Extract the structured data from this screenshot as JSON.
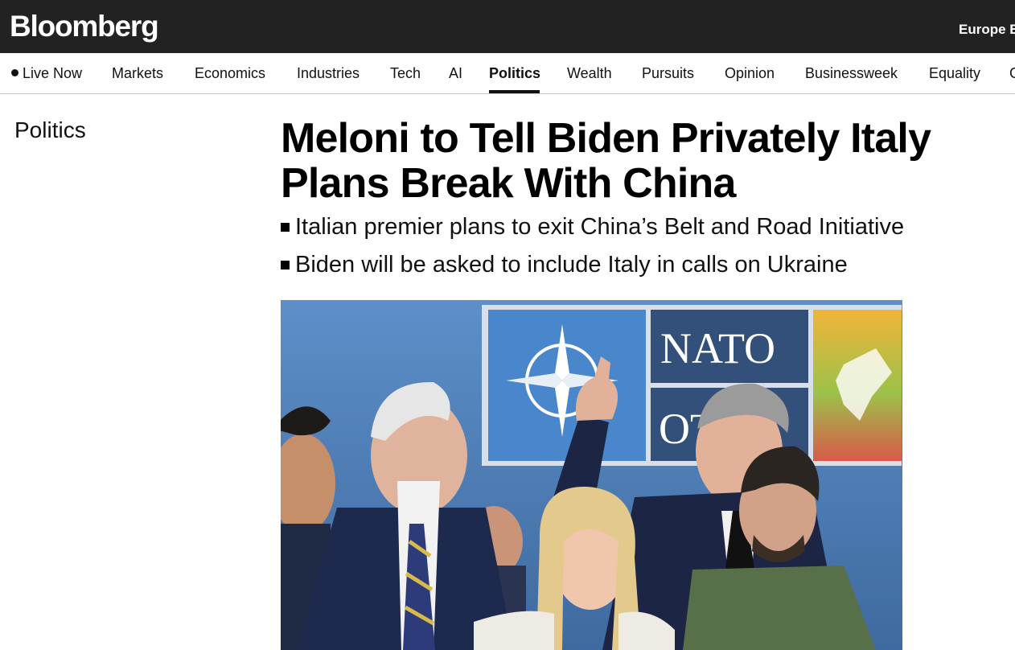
{
  "header": {
    "logo": "Bloomberg",
    "edition": "Europe E"
  },
  "nav": {
    "live_label": "Live Now",
    "items": [
      "Markets",
      "Economics",
      "Industries",
      "Tech",
      "AI",
      "Politics",
      "Wealth",
      "Pursuits",
      "Opinion",
      "Businessweek",
      "Equality",
      "G"
    ],
    "active": "Politics"
  },
  "section": "Politics",
  "article": {
    "headline": "Meloni to Tell Biden Privately Italy Plans Break With China",
    "bullets": [
      "Italian premier plans to exit China’s Belt and Road Initiative",
      "Biden will be asked to include Italy in calls on Ukraine"
    ]
  },
  "photo": {
    "backdrop_text_1": "NATO",
    "backdrop_text_2": "OT"
  },
  "colors": {
    "topbar": "#222222",
    "text": "#111111"
  }
}
